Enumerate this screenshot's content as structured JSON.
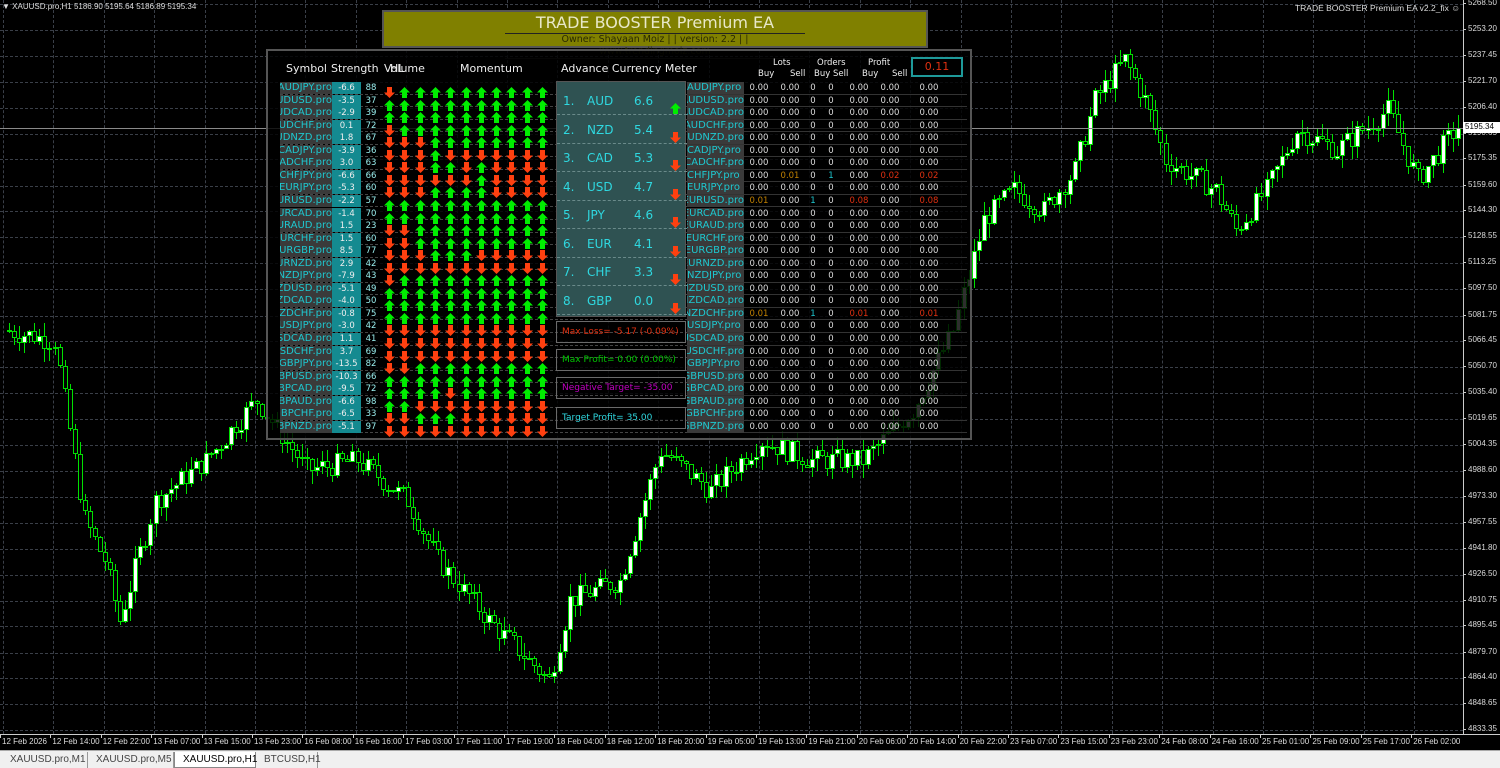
{
  "window": {
    "symbol_info": "▼ XAUUSD.pro,H1  5186.90 5195.64 5186.89 5195.34",
    "ea_label": "TRADE BOOSTER Premium EA  v2.2_fix",
    "ea_icon": "smiley-icon",
    "current_price": "5195.34"
  },
  "banner": {
    "title": "TRADE BOOSTER Premium EA",
    "subtitle": "Owner: Shayaan Moiz | | version: 2.2 | | www.trendingmoiz.com"
  },
  "panel": {
    "headers": {
      "symbol": "Symbol",
      "strength": "Strength",
      "hl": "HL",
      "volume": "Volume",
      "momentum": "Momentum",
      "meter": "Advance Currency Meter",
      "lots": "Lots",
      "orders": "Orders",
      "profit": "Profit",
      "buy": "Buy",
      "sell": "Sell"
    },
    "total_profit": "0.11",
    "rows": [
      {
        "symbol": "AUDJPY.pro",
        "strength": "-6.6",
        "hl": "88",
        "arrows": "DUUUUUUUUUU",
        "lots_buy": "0.00",
        "lots_sell": "0.00",
        "orders_buy": "0",
        "orders_sell": "0",
        "profit_buy": "0.00",
        "profit_sell": "0.00",
        "total": "0.00"
      },
      {
        "symbol": "AUDUSD.pro",
        "strength": "-3.5",
        "hl": "37",
        "arrows": "UUUUUUUUUUU",
        "lots_buy": "0.00",
        "lots_sell": "0.00",
        "orders_buy": "0",
        "orders_sell": "0",
        "profit_buy": "0.00",
        "profit_sell": "0.00",
        "total": "0.00"
      },
      {
        "symbol": "AUDCAD.pro",
        "strength": "-2.9",
        "hl": "39",
        "arrows": "UUUUUUUUUUU",
        "lots_buy": "0.00",
        "lots_sell": "0.00",
        "orders_buy": "0",
        "orders_sell": "0",
        "profit_buy": "0.00",
        "profit_sell": "0.00",
        "total": "0.00"
      },
      {
        "symbol": "AUDCHF.pro",
        "strength": "0.1",
        "hl": "72",
        "arrows": "DUUUUUUUUUU",
        "lots_buy": "0.00",
        "lots_sell": "0.00",
        "orders_buy": "0",
        "orders_sell": "0",
        "profit_buy": "0.00",
        "profit_sell": "0.00",
        "total": "0.00"
      },
      {
        "symbol": "AUDNZD.pro",
        "strength": "1.8",
        "hl": "67",
        "arrows": "DDDUUUUUUUU",
        "lots_buy": "0.00",
        "lots_sell": "0.00",
        "orders_buy": "0",
        "orders_sell": "0",
        "profit_buy": "0.00",
        "profit_sell": "0.00",
        "total": "0.00"
      },
      {
        "symbol": "CADJPY.pro",
        "strength": "-3.9",
        "hl": "36",
        "arrows": "DDDUDDDDDDD",
        "lots_buy": "0.00",
        "lots_sell": "0.00",
        "orders_buy": "0",
        "orders_sell": "0",
        "profit_buy": "0.00",
        "profit_sell": "0.00",
        "total": "0.00"
      },
      {
        "symbol": "CADCHF.pro",
        "strength": "3.0",
        "hl": "63",
        "arrows": "DDDUUDUDDDD",
        "lots_buy": "0.00",
        "lots_sell": "0.00",
        "orders_buy": "0",
        "orders_sell": "0",
        "profit_buy": "0.00",
        "profit_sell": "0.00",
        "total": "0.00"
      },
      {
        "symbol": "CHFJPY.pro",
        "strength": "-6.6",
        "hl": "66",
        "arrows": "DDDDDDUDDDD",
        "lots_buy": "0.00",
        "lots_sell": "0.01",
        "orders_buy": "0",
        "orders_sell": "1",
        "profit_buy": "0.00",
        "profit_sell": "0.02",
        "total": "0.02"
      },
      {
        "symbol": "EURJPY.pro",
        "strength": "-5.3",
        "hl": "60",
        "arrows": "DDDUUUUDDDD",
        "lots_buy": "0.00",
        "lots_sell": "0.00",
        "orders_buy": "0",
        "orders_sell": "0",
        "profit_buy": "0.00",
        "profit_sell": "0.00",
        "total": "0.00"
      },
      {
        "symbol": "EURUSD.pro",
        "strength": "-2.2",
        "hl": "57",
        "arrows": "UUUUUUUUUUU",
        "lots_buy": "0.01",
        "lots_sell": "0.00",
        "orders_buy": "1",
        "orders_sell": "0",
        "profit_buy": "0.08",
        "profit_sell": "0.00",
        "total": "0.08"
      },
      {
        "symbol": "EURCAD.pro",
        "strength": "-1.4",
        "hl": "70",
        "arrows": "UUUUUUUUUUU",
        "lots_buy": "0.00",
        "lots_sell": "0.00",
        "orders_buy": "0",
        "orders_sell": "0",
        "profit_buy": "0.00",
        "profit_sell": "0.00",
        "total": "0.00"
      },
      {
        "symbol": "EURAUD.pro",
        "strength": "1.5",
        "hl": "23",
        "arrows": "DDUUUUUUUUU",
        "lots_buy": "0.00",
        "lots_sell": "0.00",
        "orders_buy": "0",
        "orders_sell": "0",
        "profit_buy": "0.00",
        "profit_sell": "0.00",
        "total": "0.00"
      },
      {
        "symbol": "EURCHF.pro",
        "strength": "1.5",
        "hl": "60",
        "arrows": "DDUUUUUUUUU",
        "lots_buy": "0.00",
        "lots_sell": "0.00",
        "orders_buy": "0",
        "orders_sell": "0",
        "profit_buy": "0.00",
        "profit_sell": "0.00",
        "total": "0.00"
      },
      {
        "symbol": "EURGBP.pro",
        "strength": "8.5",
        "hl": "77",
        "arrows": "DDDUUUDDDDD",
        "lots_buy": "0.00",
        "lots_sell": "0.00",
        "orders_buy": "0",
        "orders_sell": "0",
        "profit_buy": "0.00",
        "profit_sell": "0.00",
        "total": "0.00"
      },
      {
        "symbol": "EURNZD.pro",
        "strength": "2.9",
        "hl": "42",
        "arrows": "DDDDDDDDDDD",
        "lots_buy": "0.00",
        "lots_sell": "0.00",
        "orders_buy": "0",
        "orders_sell": "0",
        "profit_buy": "0.00",
        "profit_sell": "0.00",
        "total": "0.00"
      },
      {
        "symbol": "NZDJPY.pro",
        "strength": "-7.9",
        "hl": "43",
        "arrows": "DUUUUUUUUUU",
        "lots_buy": "0.00",
        "lots_sell": "0.00",
        "orders_buy": "0",
        "orders_sell": "0",
        "profit_buy": "0.00",
        "profit_sell": "0.00",
        "total": "0.00"
      },
      {
        "symbol": "NZDUSD.pro",
        "strength": "-5.1",
        "hl": "49",
        "arrows": "UUUUUUUUUUU",
        "lots_buy": "0.00",
        "lots_sell": "0.00",
        "orders_buy": "0",
        "orders_sell": "0",
        "profit_buy": "0.00",
        "profit_sell": "0.00",
        "total": "0.00"
      },
      {
        "symbol": "NZDCAD.pro",
        "strength": "-4.0",
        "hl": "50",
        "arrows": "UUUUUUUUUUU",
        "lots_buy": "0.00",
        "lots_sell": "0.00",
        "orders_buy": "0",
        "orders_sell": "0",
        "profit_buy": "0.00",
        "profit_sell": "0.00",
        "total": "0.00"
      },
      {
        "symbol": "NZDCHF.pro",
        "strength": "-0.8",
        "hl": "75",
        "arrows": "UUUUUUUUUUU",
        "lots_buy": "0.01",
        "lots_sell": "0.00",
        "orders_buy": "1",
        "orders_sell": "0",
        "profit_buy": "0.01",
        "profit_sell": "0.00",
        "total": "0.01"
      },
      {
        "symbol": "USDJPY.pro",
        "strength": "-3.0",
        "hl": "42",
        "arrows": "DDDDDDDDDDD",
        "lots_buy": "0.00",
        "lots_sell": "0.00",
        "orders_buy": "0",
        "orders_sell": "0",
        "profit_buy": "0.00",
        "profit_sell": "0.00",
        "total": "0.00"
      },
      {
        "symbol": "USDCAD.pro",
        "strength": "1.1",
        "hl": "41",
        "arrows": "DDDDDDDDDDD",
        "lots_buy": "0.00",
        "lots_sell": "0.00",
        "orders_buy": "0",
        "orders_sell": "0",
        "profit_buy": "0.00",
        "profit_sell": "0.00",
        "total": "0.00"
      },
      {
        "symbol": "USDCHF.pro",
        "strength": "3.7",
        "hl": "69",
        "arrows": "DDDDDDDDDDD",
        "lots_buy": "0.00",
        "lots_sell": "0.00",
        "orders_buy": "0",
        "orders_sell": "0",
        "profit_buy": "0.00",
        "profit_sell": "0.00",
        "total": "0.00"
      },
      {
        "symbol": "GBPJPY.pro",
        "strength": "-13.5",
        "hl": "82",
        "arrows": "DDUUUUUUUUU",
        "lots_buy": "0.00",
        "lots_sell": "0.00",
        "orders_buy": "0",
        "orders_sell": "0",
        "profit_buy": "0.00",
        "profit_sell": "0.00",
        "total": "0.00"
      },
      {
        "symbol": "GBPUSD.pro",
        "strength": "-10.3",
        "hl": "66",
        "arrows": "UUUUUUUUUUU",
        "lots_buy": "0.00",
        "lots_sell": "0.00",
        "orders_buy": "0",
        "orders_sell": "0",
        "profit_buy": "0.00",
        "profit_sell": "0.00",
        "total": "0.00"
      },
      {
        "symbol": "GBPCAD.pro",
        "strength": "-9.5",
        "hl": "72",
        "arrows": "UUUUDUUUUUU",
        "lots_buy": "0.00",
        "lots_sell": "0.00",
        "orders_buy": "0",
        "orders_sell": "0",
        "profit_buy": "0.00",
        "profit_sell": "0.00",
        "total": "0.00"
      },
      {
        "symbol": "GBPAUD.pro",
        "strength": "-6.6",
        "hl": "98",
        "arrows": "UUDDDDDDDDD",
        "lots_buy": "0.00",
        "lots_sell": "0.00",
        "orders_buy": "0",
        "orders_sell": "0",
        "profit_buy": "0.00",
        "profit_sell": "0.00",
        "total": "0.00"
      },
      {
        "symbol": "GBPCHF.pro",
        "strength": "-6.5",
        "hl": "33",
        "arrows": "DDUUUDDDDDD",
        "lots_buy": "0.00",
        "lots_sell": "0.00",
        "orders_buy": "0",
        "orders_sell": "0",
        "profit_buy": "0.00",
        "profit_sell": "0.00",
        "total": "0.00"
      },
      {
        "symbol": "GBPNZD.pro",
        "strength": "-5.1",
        "hl": "97",
        "arrows": "DDDDDDDDDDD",
        "lots_buy": "0.00",
        "lots_sell": "0.00",
        "orders_buy": "0",
        "orders_sell": "0",
        "profit_buy": "0.00",
        "profit_sell": "0.00",
        "total": "0.00"
      }
    ],
    "meter": [
      {
        "rank": "1.",
        "currency": "AUD",
        "value": "6.6",
        "dir": "U"
      },
      {
        "rank": "2.",
        "currency": "NZD",
        "value": "5.4",
        "dir": "D"
      },
      {
        "rank": "3.",
        "currency": "CAD",
        "value": "5.3",
        "dir": "D"
      },
      {
        "rank": "4.",
        "currency": "USD",
        "value": "4.7",
        "dir": "D"
      },
      {
        "rank": "5.",
        "currency": "JPY",
        "value": "4.6",
        "dir": "D"
      },
      {
        "rank": "6.",
        "currency": "EUR",
        "value": "4.1",
        "dir": "D"
      },
      {
        "rank": "7.",
        "currency": "CHF",
        "value": "3.3",
        "dir": "D"
      },
      {
        "rank": "8.",
        "currency": "GBP",
        "value": "0.0",
        "dir": "D"
      }
    ],
    "stats": {
      "max_loss": "Max Loss= -5.17 (-0.09%)",
      "max_profit": "Max Profit= 0.00 (0.00%)",
      "negative_target": "Negative Target= -35.00",
      "target_profit": "Target Profit= 35.00"
    }
  },
  "colors": {
    "up": "#00ee00",
    "down": "#ff4010",
    "max_loss": "#e03010",
    "max_profit": "#00c800",
    "negative_target": "#c000c0",
    "target_profit": "#2fd8e0",
    "bull_fill": "#ffffff",
    "bear_fill": "#000000",
    "candle_line": "#00e000"
  },
  "chart_data": {
    "type": "candlestick",
    "price_ticks": [
      "5268.50",
      "5253.20",
      "5237.45",
      "5221.70",
      "5206.40",
      "5190.65",
      "5175.35",
      "5159.60",
      "5144.30",
      "5128.55",
      "5113.25",
      "5097.50",
      "5081.75",
      "5066.45",
      "5050.70",
      "5035.40",
      "5019.65",
      "5004.35",
      "4988.60",
      "4973.30",
      "4957.55",
      "4941.80",
      "4926.50",
      "4910.75",
      "4895.45",
      "4879.70",
      "4864.40",
      "4848.65",
      "4833.35"
    ],
    "ylim": [
      4833.35,
      5268.5
    ],
    "time_ticks": [
      "12 Feb 2026",
      "12 Feb 14:00",
      "12 Feb 22:00",
      "13 Feb 07:00",
      "13 Feb 15:00",
      "13 Feb 23:00",
      "16 Feb 08:00",
      "16 Feb 16:00",
      "17 Feb 03:00",
      "17 Feb 11:00",
      "17 Feb 19:00",
      "18 Feb 04:00",
      "18 Feb 12:00",
      "18 Feb 20:00",
      "19 Feb 05:00",
      "19 Feb 13:00",
      "19 Feb 21:00",
      "20 Feb 06:00",
      "20 Feb 14:00",
      "20 Feb 22:00",
      "23 Feb 07:00",
      "23 Feb 15:00",
      "23 Feb 23:00",
      "24 Feb 08:00",
      "24 Feb 16:00",
      "25 Feb 01:00",
      "25 Feb 09:00",
      "25 Feb 17:00",
      "26 Feb 02:00"
    ],
    "approx_close_path": [
      [
        0,
        5073
      ],
      [
        10,
        5067
      ],
      [
        16,
        4959
      ],
      [
        20,
        4935
      ],
      [
        23,
        4899
      ],
      [
        30,
        4971
      ],
      [
        40,
        4995
      ],
      [
        50,
        5031
      ],
      [
        60,
        4989
      ],
      [
        70,
        4995
      ],
      [
        80,
        4971
      ],
      [
        86,
        4935
      ],
      [
        96,
        4899
      ],
      [
        100,
        4887
      ],
      [
        108,
        4863
      ],
      [
        112,
        4911
      ],
      [
        122,
        4923
      ],
      [
        130,
        5001
      ],
      [
        140,
        4977
      ],
      [
        150,
        5007
      ],
      [
        160,
        4995
      ],
      [
        170,
        4995
      ],
      [
        180,
        5025
      ],
      [
        188,
        5073
      ],
      [
        194,
        5139
      ],
      [
        200,
        5157
      ],
      [
        206,
        5145
      ],
      [
        212,
        5169
      ],
      [
        216,
        5211
      ],
      [
        222,
        5235
      ],
      [
        226,
        5211
      ],
      [
        230,
        5175
      ],
      [
        240,
        5157
      ],
      [
        244,
        5133
      ],
      [
        250,
        5157
      ],
      [
        256,
        5193
      ],
      [
        264,
        5181
      ],
      [
        274,
        5205
      ],
      [
        280,
        5163
      ],
      [
        288,
        5195.34
      ]
    ]
  },
  "tabs": [
    "XAUUSD.pro,M1",
    "XAUUSD.pro,M5",
    "XAUUSD.pro,H1",
    "BTCUSD,H1"
  ],
  "active_tab": "XAUUSD.pro,H1"
}
